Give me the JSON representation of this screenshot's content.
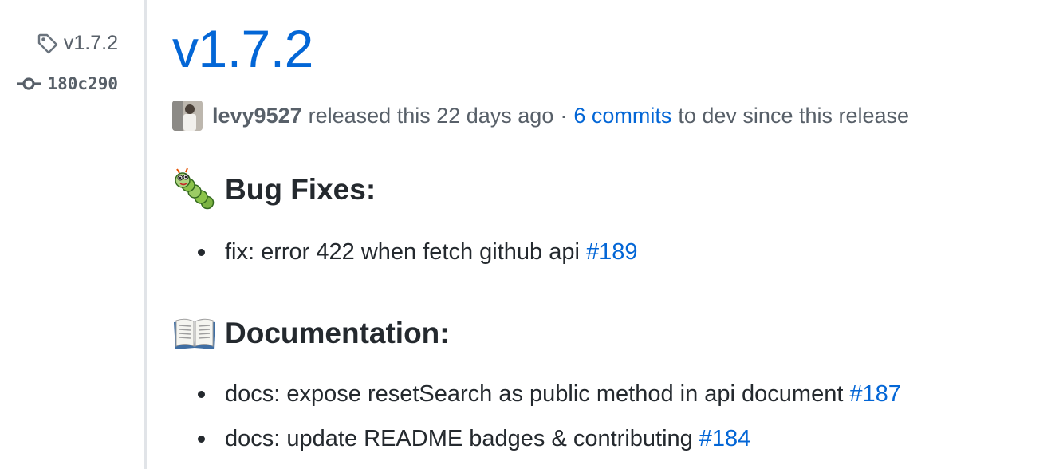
{
  "sidebar": {
    "tag_label": "v1.7.2",
    "commit_sha": "180c290"
  },
  "release": {
    "title": "v1.7.2",
    "author": "levy9527",
    "released_text": "released this 22 days ago",
    "separator": "·",
    "commits_link": "6 commits",
    "commits_suffix": "to dev since this release"
  },
  "sections": [
    {
      "heading": "Bug Fixes:",
      "icon": "caterpillar-emoji",
      "items": [
        {
          "text": "fix: error 422 when fetch github api",
          "ref": "#189"
        }
      ]
    },
    {
      "heading": "Documentation:",
      "icon": "open-book-emoji",
      "items": [
        {
          "text": "docs: expose resetSearch as public method in api document",
          "ref": "#187"
        },
        {
          "text": "docs: update README badges & contributing",
          "ref": "#184"
        }
      ]
    }
  ],
  "colors": {
    "link": "#0366d6",
    "muted": "#586069",
    "text": "#24292e",
    "divider": "#e1e4e8"
  }
}
